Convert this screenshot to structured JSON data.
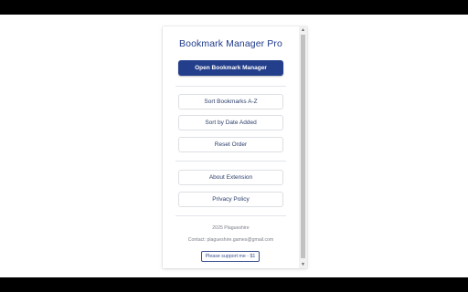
{
  "app": {
    "title": "Bookmark Manager Pro"
  },
  "actions": {
    "open_label": "Open Bookmark Manager",
    "sort_az_label": "Sort Bookmarks A-Z",
    "sort_date_label": "Sort by Date Added",
    "reset_label": "Reset Order",
    "about_label": "About Extension",
    "privacy_label": "Privacy Policy"
  },
  "footer": {
    "copyright": "2025 Plagueshire",
    "contact": "Contact: plagueshire.games@gmail.com",
    "support_label": "Please support me - $1"
  },
  "colors": {
    "primary": "#233e8b",
    "title": "#1f3a8a",
    "background_bar": "#000000"
  },
  "icons": {
    "scroll_up": "scroll-up-arrow-icon",
    "scroll_down": "scroll-down-arrow-icon"
  }
}
